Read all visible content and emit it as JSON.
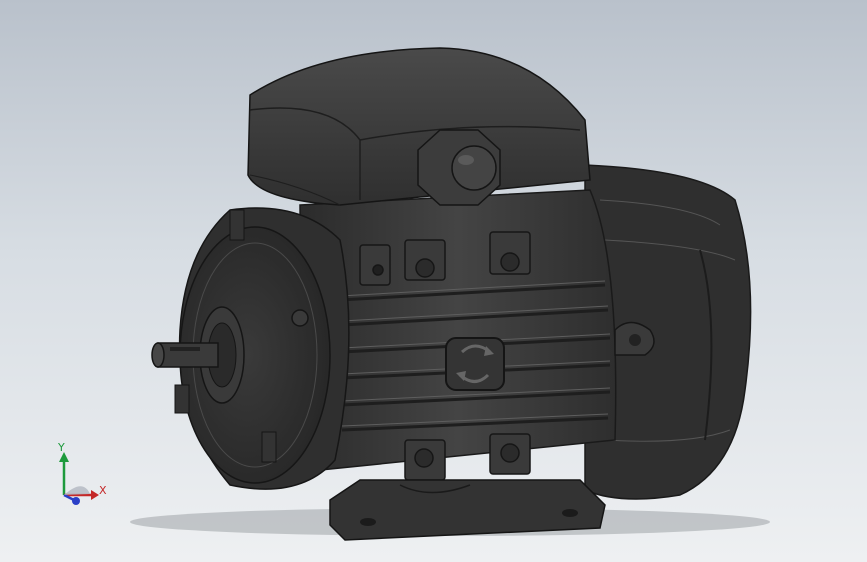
{
  "viewport": {
    "background_top": "#b9c1cb",
    "background_bottom": "#eef0f2",
    "model_color": "#3b3b3b"
  },
  "triad": {
    "x_label": "X",
    "y_label": "Y",
    "x_color": "#c42828",
    "y_color": "#1d9a3c",
    "z_color": "#2a3fc7"
  }
}
